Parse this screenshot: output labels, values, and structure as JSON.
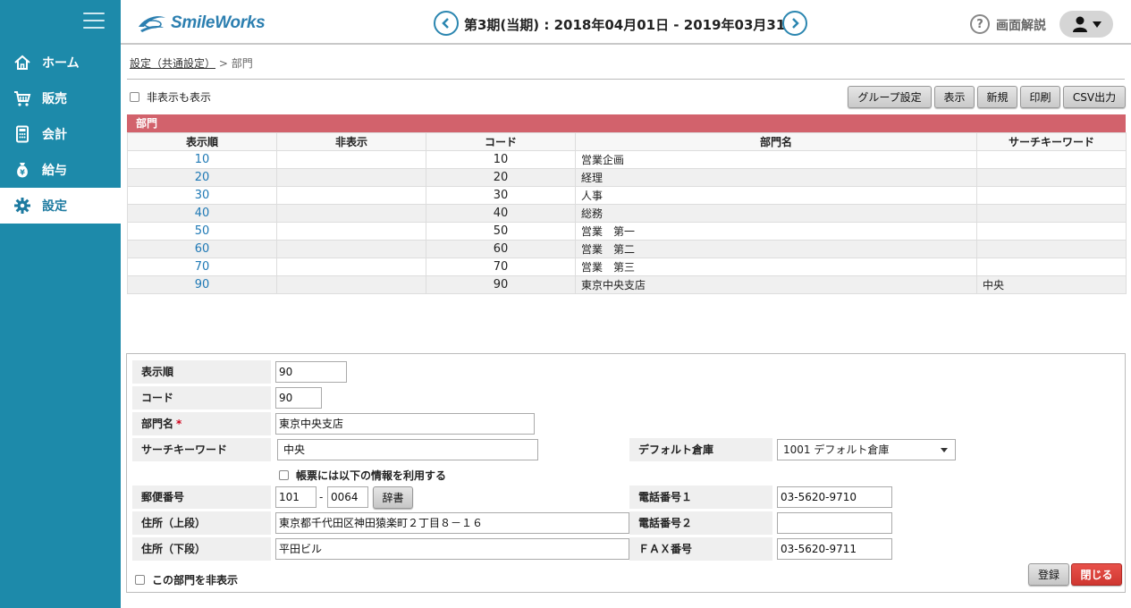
{
  "header": {
    "logo_text": "SmileWorks",
    "period": "第3期(当期) : 2018年04月01日 - 2019年03月31日",
    "help_label": "画面解説"
  },
  "sidebar": {
    "items": [
      {
        "label": "ホーム",
        "icon": "home-icon"
      },
      {
        "label": "販売",
        "icon": "cart-icon"
      },
      {
        "label": "会計",
        "icon": "calculator-icon"
      },
      {
        "label": "給与",
        "icon": "money-bag-icon"
      },
      {
        "label": "設定",
        "icon": "gear-icon",
        "active": true
      }
    ]
  },
  "breadcrumb": {
    "parent": "設定（共通設定）",
    "separator": ">",
    "current": "部門"
  },
  "toolbar": {
    "show_hidden_label": "非表示も表示",
    "group_settings": "グループ設定",
    "display": "表示",
    "new": "新規",
    "print": "印刷",
    "csv": "CSV出力"
  },
  "table": {
    "title": "部門",
    "columns": [
      "表示順",
      "非表示",
      "コード",
      "部門名",
      "サーチキーワード"
    ],
    "rows": [
      {
        "order": "10",
        "hidden": "",
        "code": "10",
        "name": "営業企画",
        "keyword": ""
      },
      {
        "order": "20",
        "hidden": "",
        "code": "20",
        "name": "経理",
        "keyword": ""
      },
      {
        "order": "30",
        "hidden": "",
        "code": "30",
        "name": "人事",
        "keyword": ""
      },
      {
        "order": "40",
        "hidden": "",
        "code": "40",
        "name": "総務",
        "keyword": ""
      },
      {
        "order": "50",
        "hidden": "",
        "code": "50",
        "name": "営業　第一",
        "keyword": ""
      },
      {
        "order": "60",
        "hidden": "",
        "code": "60",
        "name": "営業　第二",
        "keyword": ""
      },
      {
        "order": "70",
        "hidden": "",
        "code": "70",
        "name": "営業　第三",
        "keyword": ""
      },
      {
        "order": "90",
        "hidden": "",
        "code": "90",
        "name": "東京中央支店",
        "keyword": "中央"
      }
    ]
  },
  "form": {
    "order_label": "表示順",
    "order_value": "90",
    "code_label": "コード",
    "code_value": "90",
    "name_label": "部門名",
    "required_mark": "*",
    "name_value": "東京中央支店",
    "keyword_label": "サーチキーワード",
    "keyword_value": "中央",
    "warehouse_label": "デフォルト倉庫",
    "warehouse_value": "1001 デフォルト倉庫",
    "use_info_label": "帳票には以下の情報を利用する",
    "postal_label": "郵便番号",
    "postal1": "101",
    "postal_sep": "-",
    "postal2": "0064",
    "dict_button": "辞書",
    "phone1_label": "電話番号１",
    "phone1_value": "03-5620-9710",
    "address1_label": "住所（上段）",
    "address1_value": "東京都千代田区神田猿楽町２丁目８－１６",
    "phone2_label": "電話番号２",
    "phone2_value": "",
    "address2_label": "住所（下段）",
    "address2_value": "平田ビル",
    "fax_label": "ＦＡＸ番号",
    "fax_value": "03-5620-9711",
    "hide_dept_label": "この部門を非表示",
    "register_button": "登録",
    "close_button": "閉じる"
  },
  "colors": {
    "sidebar": "#1d8aaa",
    "table_header": "#d2626c",
    "link": "#1f79b5",
    "close_button": "#d9433d"
  }
}
